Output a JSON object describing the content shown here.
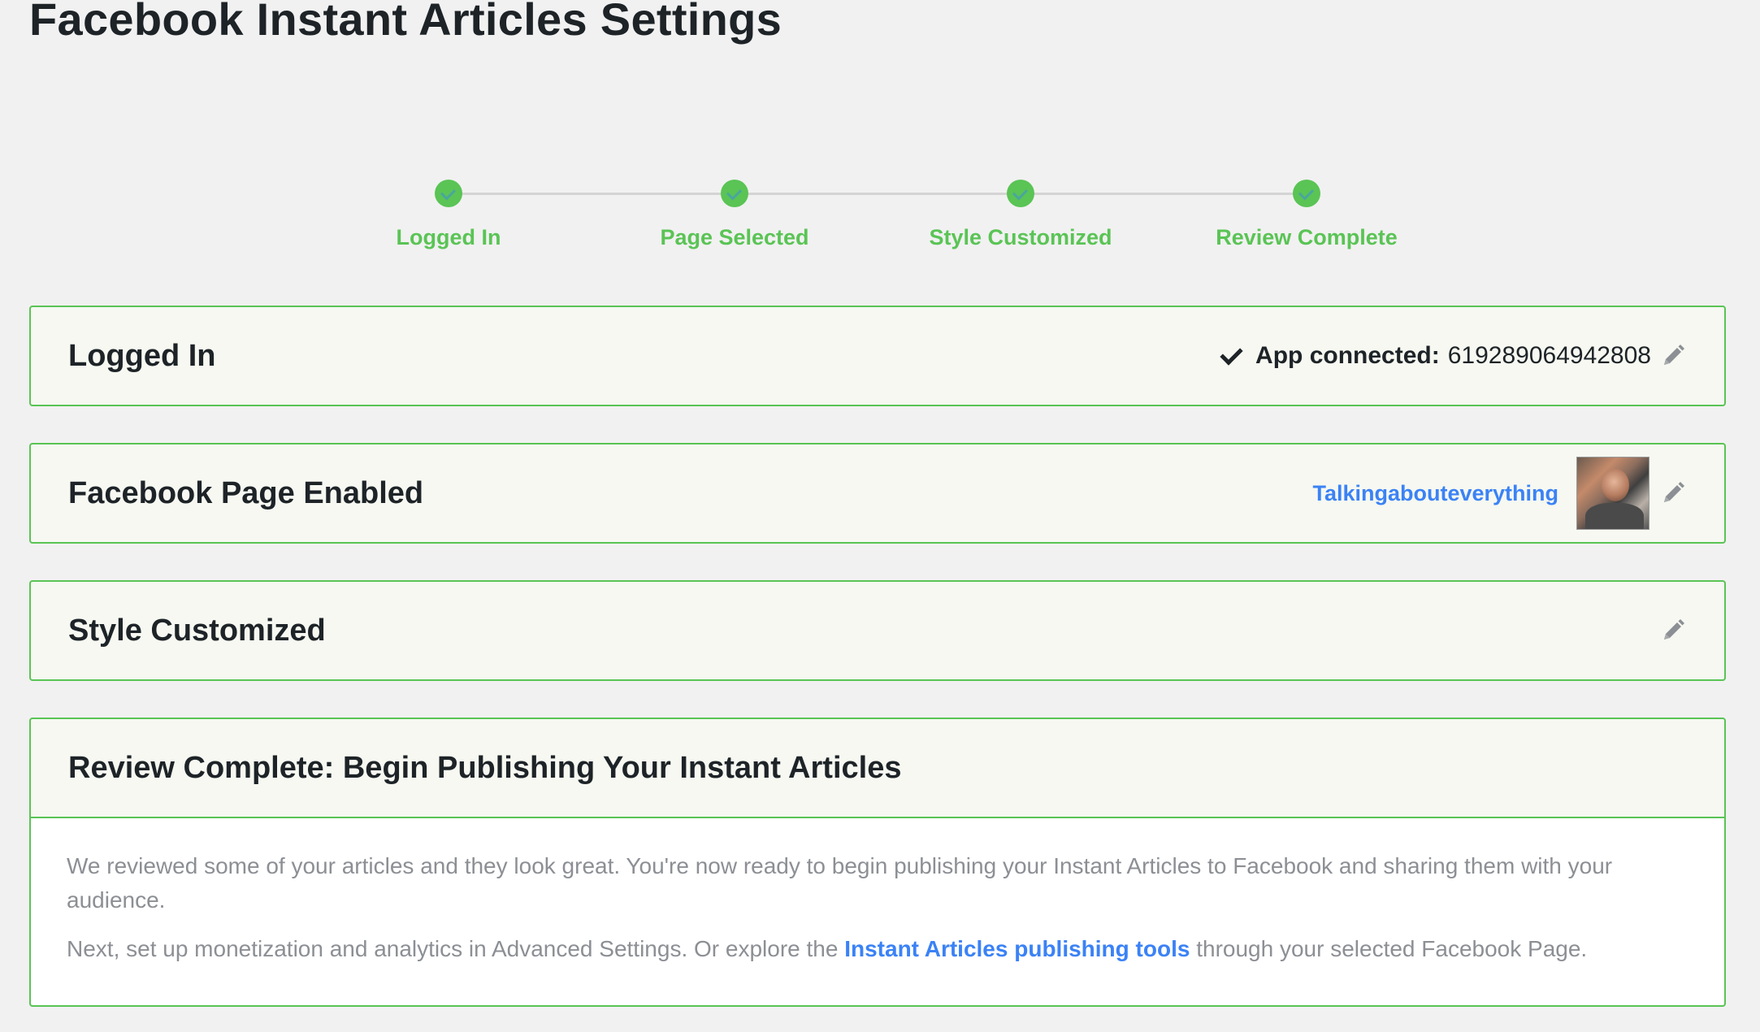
{
  "page": {
    "title": "Facebook Instant Articles Settings"
  },
  "steps": [
    {
      "label": "Logged In"
    },
    {
      "label": "Page Selected"
    },
    {
      "label": "Style Customized"
    },
    {
      "label": "Review Complete"
    }
  ],
  "panels": {
    "logged_in": {
      "title": "Logged In",
      "app_label": "App connected:",
      "app_id": "619289064942808"
    },
    "page_enabled": {
      "title": "Facebook Page Enabled",
      "page_name": "Talkingabouteverything"
    },
    "style": {
      "title": "Style Customized"
    },
    "review": {
      "title": "Review Complete: Begin Publishing Your Instant Articles",
      "para1": "We reviewed some of your articles and they look great. You're now ready to begin publishing your Instant Articles to Facebook and sharing them with your audience.",
      "para2_before": "Next, set up monetization and analytics in Advanced Settings. Or explore the ",
      "para2_link": "Instant Articles publishing tools",
      "para2_after": " through your selected Facebook Page."
    }
  },
  "colors": {
    "accent_green": "#5ac455",
    "link_blue": "#3b82f6",
    "panel_bg": "#f6f8f1",
    "page_bg": "#f1f1f1"
  },
  "icons": [
    "check-icon",
    "pencil-icon",
    "step-complete-icon"
  ]
}
